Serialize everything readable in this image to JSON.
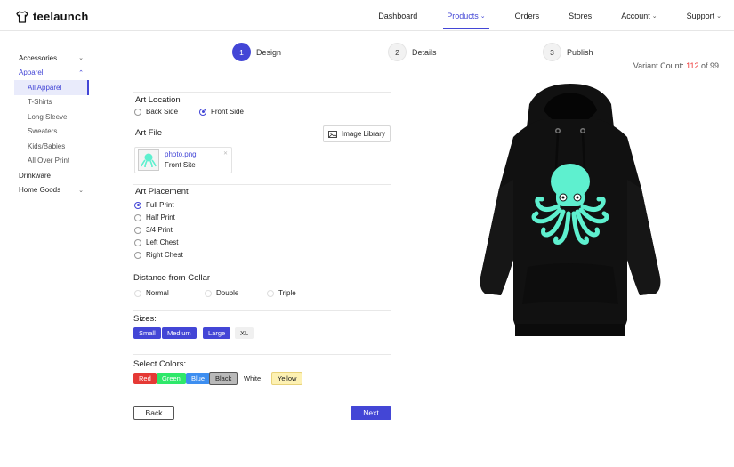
{
  "app": {
    "logo_text": "teelaunch"
  },
  "nav": [
    {
      "label": "Dashboard",
      "chevron": false,
      "active": false
    },
    {
      "label": "Products",
      "chevron": true,
      "active": true
    },
    {
      "label": "Orders",
      "chevron": false,
      "active": false
    },
    {
      "label": "Stores",
      "chevron": false,
      "active": false
    },
    {
      "label": "Account",
      "chevron": true,
      "active": false
    },
    {
      "label": "Support",
      "chevron": true,
      "active": false
    }
  ],
  "sidebar": {
    "categories": [
      {
        "label": "Accessories",
        "chevron": "down"
      },
      {
        "label": "Apparel",
        "chevron": "up",
        "open": true
      },
      {
        "label": "Drinkware"
      },
      {
        "label": "Home Goods",
        "chevron": "down"
      }
    ],
    "apparel_subitems": [
      "All Apparel",
      "T-Shirts",
      "Long Sleeve",
      "Sweaters",
      "Kids/Babies",
      "All Over Print"
    ],
    "selected_subitem": "All Apparel"
  },
  "stepper": [
    {
      "number": "1",
      "label": "Design",
      "active": true
    },
    {
      "number": "2",
      "label": "Details",
      "active": false
    },
    {
      "number": "3",
      "label": "Publish",
      "active": false
    }
  ],
  "variant": {
    "prefix": "Variant Count: ",
    "count": "112",
    "suffix": " of 99"
  },
  "art_location": {
    "title": "Art Location",
    "options": [
      "Back Side",
      "Front Side"
    ],
    "selected": "Front Side"
  },
  "art_file": {
    "title": "Art File",
    "library_button": "Image Library",
    "file_name": "photo.png",
    "file_side": "Front Site"
  },
  "art_placement": {
    "title": "Art Placement",
    "options": [
      "Full Print",
      "Half Print",
      "3/4 Print",
      "Left Chest",
      "Right Chest"
    ],
    "selected": "Full Print"
  },
  "collar": {
    "title": "Distance from Collar",
    "options": [
      "Normal",
      "Double",
      "Triple"
    ]
  },
  "sizes": {
    "title": "Sizes:",
    "items": [
      {
        "label": "Small",
        "selected": true
      },
      {
        "label": "Medium",
        "selected": true
      },
      {
        "label": "Large",
        "selected": true
      },
      {
        "label": "XL",
        "selected": false
      }
    ]
  },
  "colors": {
    "title": "Select Colors:",
    "items": [
      {
        "label": "Red",
        "bg": "#e53935",
        "fg": "#ffffff"
      },
      {
        "label": "Green",
        "bg": "#2ee86a",
        "fg": "#ffffff"
      },
      {
        "label": "Blue",
        "bg": "#3d8ef0",
        "fg": "#ffffff"
      },
      {
        "label": "Black",
        "bg": "#b9b9b9",
        "fg": "#222222",
        "border": "#555555"
      },
      {
        "label": "White",
        "bg": "#ffffff",
        "fg": "#222222"
      },
      {
        "label": "Yellow",
        "bg": "#fdf1b3",
        "fg": "#222222",
        "border": "#e8d27a"
      }
    ]
  },
  "buttons": {
    "back": "Back",
    "next": "Next"
  },
  "theme": {
    "accent": "#4346d6",
    "hoodie": "#111111",
    "octopus": "#5ef0cf"
  }
}
